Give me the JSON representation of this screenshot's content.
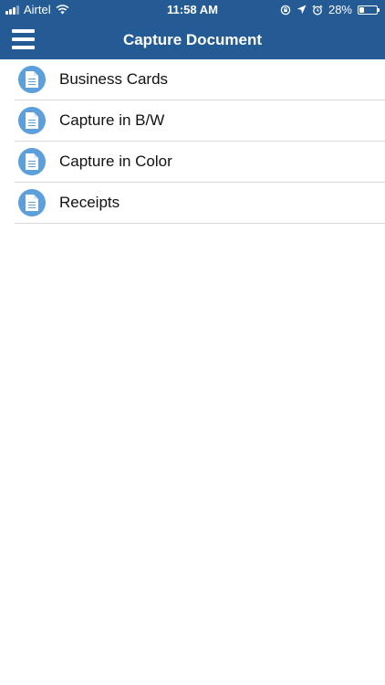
{
  "status_bar": {
    "carrier": "Airtel",
    "time": "11:58 AM",
    "battery_percent": "28%",
    "battery_level": 0.28
  },
  "header": {
    "title": "Capture Document",
    "menu_icon": "hamburger-menu-icon"
  },
  "colors": {
    "header_background": "#245b94",
    "icon_circle": "#5c9fdb",
    "divider": "#d9d9d9"
  },
  "list": {
    "items": [
      {
        "label": "Business Cards",
        "icon": "document-icon"
      },
      {
        "label": "Capture in B/W",
        "icon": "document-icon"
      },
      {
        "label": "Capture in Color",
        "icon": "document-icon"
      },
      {
        "label": "Receipts",
        "icon": "document-icon"
      }
    ]
  }
}
